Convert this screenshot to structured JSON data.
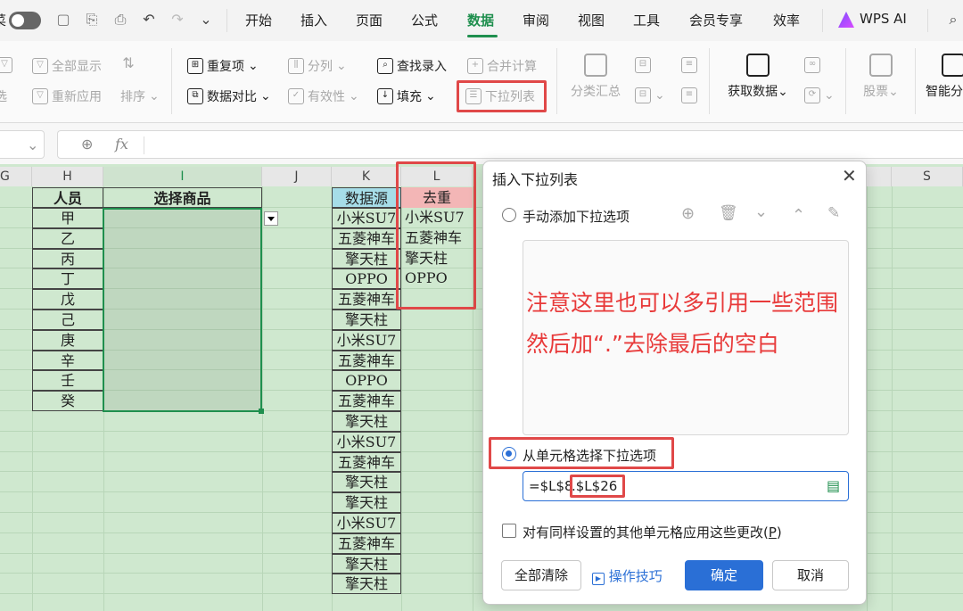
{
  "menu": {
    "tabs": [
      "开始",
      "插入",
      "页面",
      "公式",
      "数据",
      "审阅",
      "视图",
      "工具",
      "会员专享",
      "效率"
    ],
    "active": "数据",
    "wps_ai": "WPS AI"
  },
  "ribbon": {
    "show_all": "全部显示",
    "reapply": "重新应用",
    "sort": "排序",
    "duplicates": "重复项",
    "compare": "数据对比",
    "split": "分列",
    "validity": "有效性",
    "lookup_entry": "查找录入",
    "fill": "填充",
    "merge_calc": "合并计算",
    "dropdown_list": "下拉列表",
    "subtotal": "分类汇总",
    "get_data": "获取数据",
    "stocks": "股票",
    "smart": "智能分"
  },
  "formula": {
    "fx": "fx"
  },
  "columns": [
    "G",
    "H",
    "I",
    "J",
    "K",
    "L",
    "S"
  ],
  "sheet": {
    "person_header": "人员",
    "product_header": "选择商品",
    "persons": [
      "甲",
      "乙",
      "丙",
      "丁",
      "戊",
      "己",
      "庚",
      "辛",
      "壬",
      "癸"
    ],
    "source_header": "数据源",
    "source": [
      "小米SU7",
      "五菱神车",
      "擎天柱",
      "OPPO",
      "五菱神车",
      "擎天柱",
      "小米SU7",
      "五菱神车",
      "OPPO",
      "五菱神车",
      "擎天柱",
      "小米SU7",
      "五菱神车",
      "擎天柱",
      "擎天柱",
      "小米SU7",
      "五菱神车",
      "擎天柱",
      "擎天柱"
    ],
    "dedup_header": "去重",
    "dedup": [
      "小米SU7",
      "五菱神车",
      "擎天柱",
      "OPPO"
    ]
  },
  "dialog": {
    "title": "插入下拉列表",
    "manual_option": "手动添加下拉选项",
    "note_line1": "注意这里也可以多引用一些范围",
    "note_line2": "然后加“.”去除最后的空白",
    "cell_option": "从单元格选择下拉选项",
    "ref_prefix": "=$L$8",
    "ref_suffix": ".$L$26",
    "apply_all": "对有同样设置的其他单元格应用这些更改(",
    "apply_all_key": "P",
    "apply_all_end": ")",
    "clear_all": "全部清除",
    "tips": "操作技巧",
    "ok": "确定",
    "cancel": "取消",
    "note_color": "#e83a3a",
    "accent": "#2a6fd6"
  }
}
